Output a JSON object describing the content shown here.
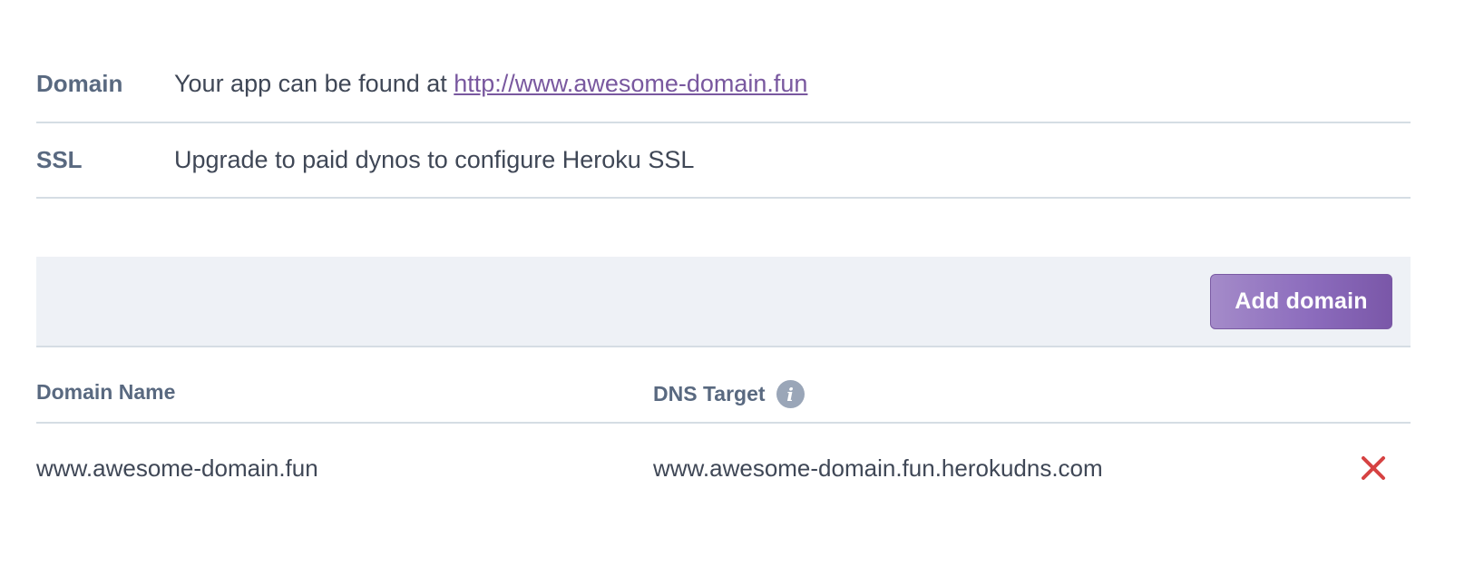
{
  "settings": {
    "domain_label": "Domain",
    "domain_prefix": "Your app can be found at ",
    "domain_url": "http://www.awesome-domain.fun",
    "ssl_label": "SSL",
    "ssl_text": "Upgrade to paid dynos to configure Heroku SSL"
  },
  "toolbar": {
    "add_domain_label": "Add domain"
  },
  "table": {
    "headers": {
      "domain_name": "Domain Name",
      "dns_target": "DNS Target"
    },
    "info_icon_glyph": "i",
    "rows": [
      {
        "domain_name": "www.awesome-domain.fun",
        "dns_target": "www.awesome-domain.fun.herokudns.com"
      }
    ]
  },
  "colors": {
    "link": "#79589f",
    "button": "#8c6cbd",
    "remove": "#d64242",
    "label": "#596980"
  },
  "icons": {
    "info": "info-icon",
    "remove": "close-icon"
  }
}
